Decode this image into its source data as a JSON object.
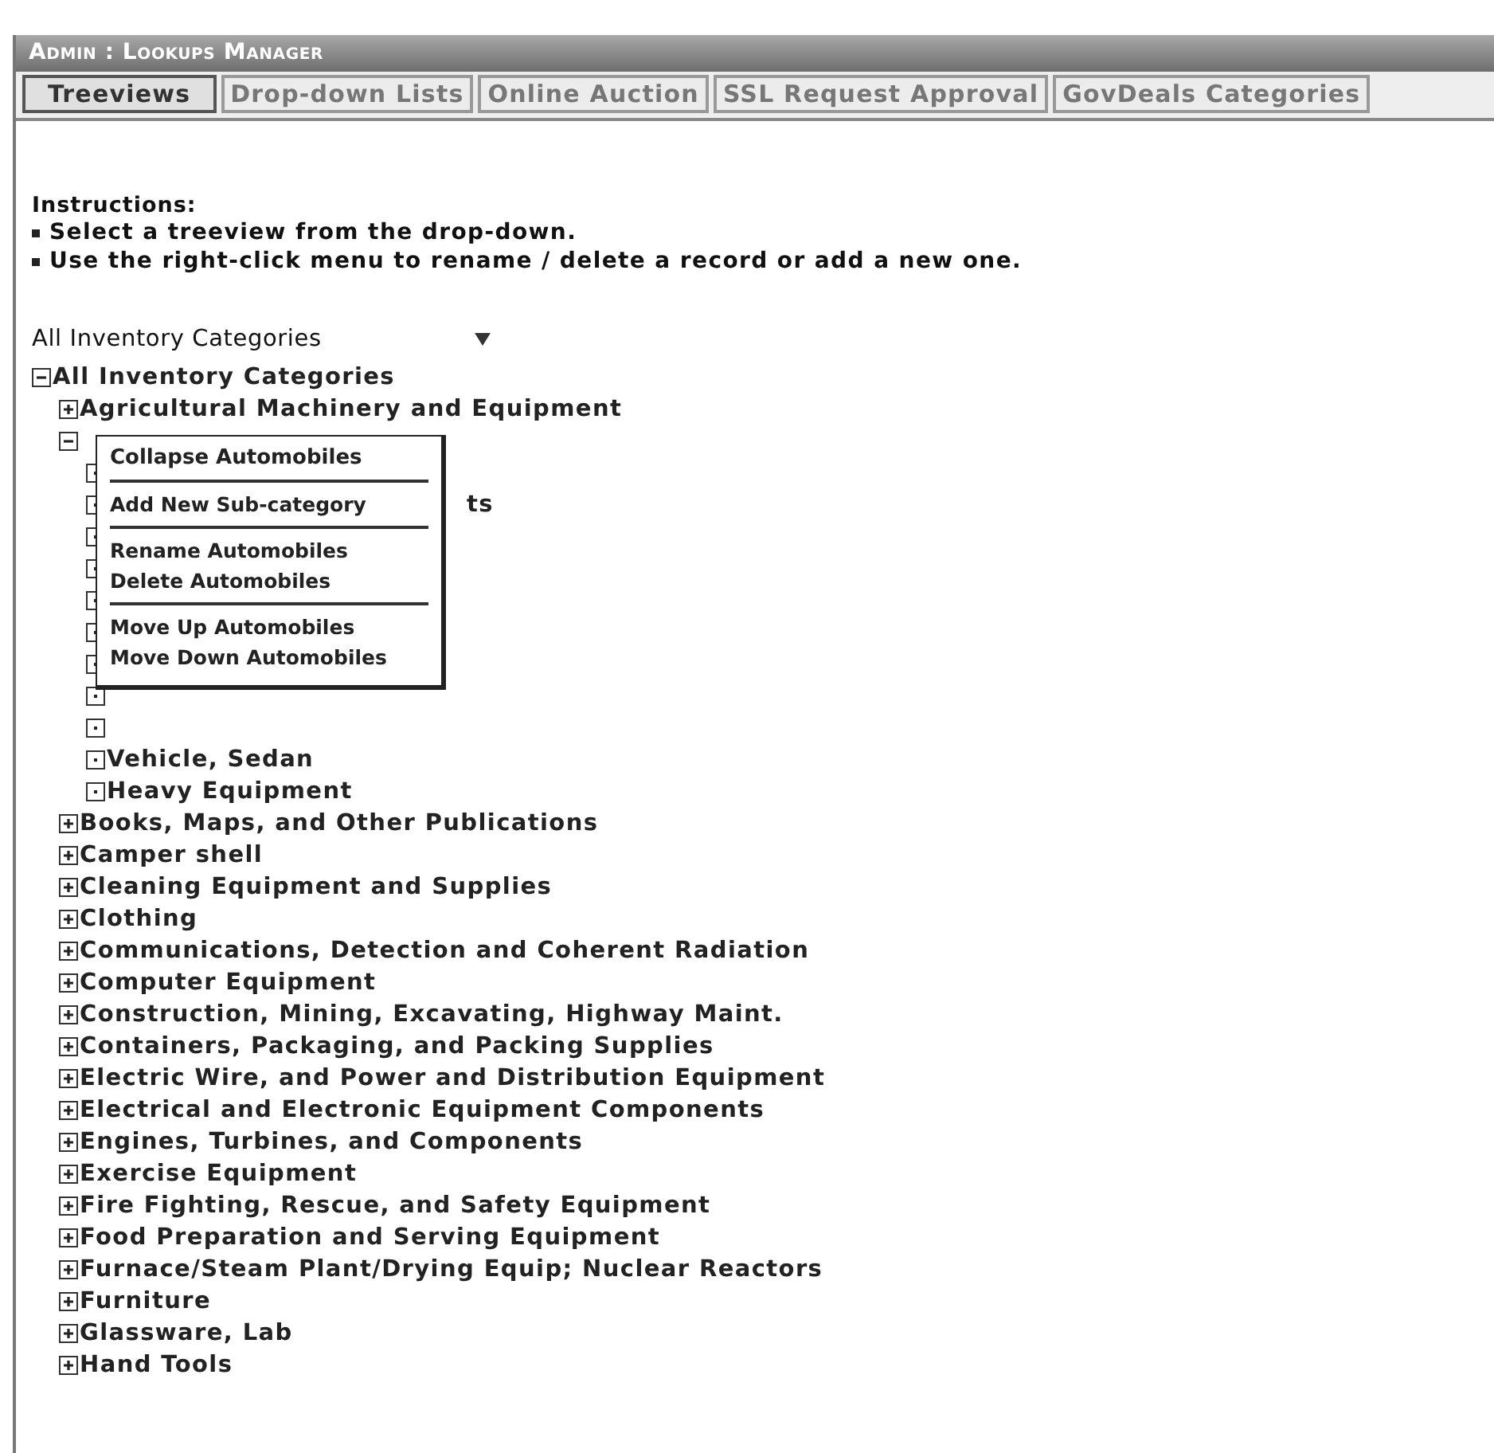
{
  "panel": {
    "title": "Admin : Lookups Manager"
  },
  "tabs": [
    {
      "label": "Treeviews",
      "selected": true
    },
    {
      "label": "Drop-down Lists",
      "selected": false
    },
    {
      "label": "Online Auction",
      "selected": false
    },
    {
      "label": "SSL Request Approval",
      "selected": false
    },
    {
      "label": "GovDeals Categories",
      "selected": false
    }
  ],
  "instructions": {
    "heading": "Instructions:",
    "items": [
      "Select a treeview from the drop-down.",
      "Use the right-click menu to rename / delete a record or add a new one."
    ]
  },
  "treeview_select": {
    "value": "All Inventory Categories"
  },
  "tree": [
    {
      "label": "All Inventory Categories",
      "expanded": true,
      "children": [
        {
          "label": "Agricultural Machinery and Equipment",
          "expanded": false
        },
        {
          "kind": "context",
          "expanded": true,
          "children": [
            {
              "kind": "covered"
            },
            {
              "kind": "covered",
              "label": "ts"
            },
            {
              "kind": "covered"
            },
            {
              "kind": "covered"
            },
            {
              "kind": "covered"
            },
            {
              "kind": "covered"
            },
            {
              "kind": "covered"
            },
            {
              "kind": "covered"
            },
            {
              "kind": "covered"
            },
            {
              "label": "Vehicle, Sedan",
              "kind": "leaf"
            },
            {
              "label": "Heavy Equipment",
              "kind": "leaf"
            }
          ]
        },
        {
          "label": "Books, Maps, and Other Publications",
          "expanded": false
        },
        {
          "label": "Camper shell",
          "expanded": false
        },
        {
          "label": "Cleaning Equipment and Supplies",
          "expanded": false
        },
        {
          "label": "Clothing",
          "expanded": false
        },
        {
          "label": "Communications, Detection and Coherent Radiation",
          "expanded": false
        },
        {
          "label": "Computer Equipment",
          "expanded": false
        },
        {
          "label": "Construction, Mining, Excavating, Highway Maint.",
          "expanded": false
        },
        {
          "label": "Containers, Packaging, and Packing Supplies",
          "expanded": false
        },
        {
          "label": "Electric Wire, and Power and Distribution Equipment",
          "expanded": false
        },
        {
          "label": "Electrical and Electronic Equipment Components",
          "expanded": false
        },
        {
          "label": "Engines, Turbines, and Components",
          "expanded": false
        },
        {
          "label": "Exercise Equipment",
          "expanded": false
        },
        {
          "label": "Fire Fighting, Rescue, and Safety Equipment",
          "expanded": false
        },
        {
          "label": "Food Preparation and Serving Equipment",
          "expanded": false
        },
        {
          "label": "Furnace/Steam Plant/Drying Equip; Nuclear Reactors",
          "expanded": false
        },
        {
          "label": "Furniture",
          "expanded": false
        },
        {
          "label": "Glassware, Lab",
          "expanded": false
        },
        {
          "label": "Hand Tools",
          "expanded": false
        }
      ]
    }
  ],
  "context_menu": {
    "groups": [
      [
        "Collapse Automobiles"
      ],
      [
        "Add New Sub-category"
      ],
      [
        "Rename Automobiles",
        "Delete Automobiles"
      ],
      [
        "Move Up Automobiles",
        "Move Down Automobiles"
      ]
    ]
  }
}
